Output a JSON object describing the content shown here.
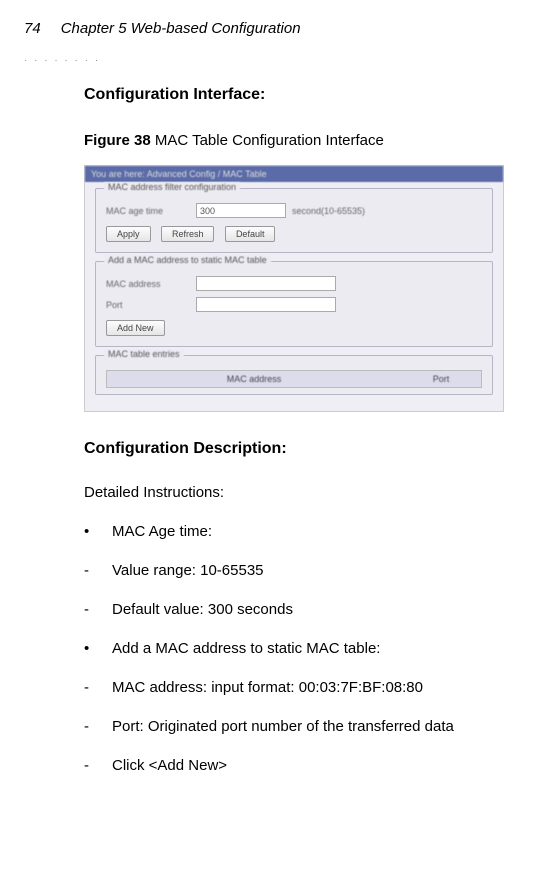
{
  "header": {
    "page_number": "74",
    "chapter": "Chapter 5 Web-based Configuration"
  },
  "section1_title": "Configuration Interface:",
  "figure": {
    "number": "Figure 38",
    "caption": " MAC Table Configuration Interface"
  },
  "screenshot": {
    "breadcrumb": "You are here: Advanced Config / MAC Table",
    "fieldset1": {
      "legend": "MAC address filter configuration",
      "label_age": "MAC age time",
      "value_age": "300",
      "suffix_age": "second(10-65535)",
      "btn_apply": "Apply",
      "btn_refresh": "Refresh",
      "btn_default": "Default"
    },
    "fieldset2": {
      "legend": "Add a MAC address to static MAC table",
      "label_mac": "MAC address",
      "label_port": "Port",
      "btn_add": "Add New"
    },
    "fieldset3": {
      "legend": "MAC table entries",
      "th_mac": "MAC address",
      "th_port": "Port"
    }
  },
  "section2_title": "Configuration Description:",
  "instructions_label": "Detailed Instructions:",
  "bullets": {
    "b1": "MAC Age time:",
    "d1": "Value range: 10-65535",
    "d2": "Default value: 300 seconds",
    "b2": "Add a MAC address to static MAC table:",
    "d3": "MAC address: input format: 00:03:7F:BF:08:80",
    "d4": "Port: Originated port number of the transferred data",
    "d5": "Click <Add New>"
  }
}
